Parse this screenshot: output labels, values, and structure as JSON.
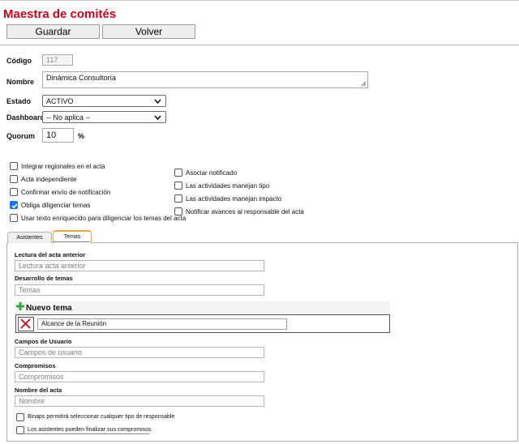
{
  "page": {
    "title": "Maestra de comités",
    "save_label": "Guardar",
    "back_label": "Volver"
  },
  "form": {
    "codigo": {
      "label": "Código",
      "value": "117"
    },
    "nombre": {
      "label": "Nombre",
      "value": "Dinámica Consultoría"
    },
    "estado": {
      "label": "Estado",
      "value": "ACTIVO"
    },
    "dashboard": {
      "label": "Dashboard",
      "value": "-- No aplica --"
    },
    "quorum": {
      "label": "Quorum",
      "value": "10",
      "unit": "%"
    }
  },
  "options_left": [
    {
      "label": "Integrar regionales en el acta",
      "checked": false
    },
    {
      "label": "Acta independiente",
      "checked": false
    },
    {
      "label": "Confirmar envío de notificación",
      "checked": false
    },
    {
      "label": "Obliga diligenciar temas",
      "checked": true
    },
    {
      "label": "Usar texto enriquecido para diligenciar los temas del acta",
      "checked": false
    }
  ],
  "options_right": [
    {
      "label": "Asociar notificado",
      "checked": false
    },
    {
      "label": "Las actividades manejan tipo",
      "checked": false
    },
    {
      "label": "Las actividades manejan impacto",
      "checked": false
    },
    {
      "label": "Notificar avances al responsable del acta",
      "checked": false
    }
  ],
  "tabs": [
    {
      "label": "Asistentes",
      "active": false
    },
    {
      "label": "Temas",
      "active": true
    }
  ],
  "temas_panel": {
    "lectura": {
      "label": "Lectura del acta anterior",
      "placeholder": "Lectura acta anterior"
    },
    "desarrollo": {
      "label": "Desarrollo de temas",
      "placeholder": "Temas"
    },
    "nuevo_tema_label": "Nuevo tema",
    "tema_item_value": "Alcance de la Reunión",
    "campos": {
      "label": "Campos de Usuario",
      "placeholder": "Campos de usuario"
    },
    "compromisos": {
      "label": "Compromisos",
      "placeholder": "Compromisos"
    },
    "nombre_acta": {
      "label": "Nombre del acta",
      "placeholder": "Nombre"
    },
    "check_binaps": {
      "label": "Binaps permitirá seleccionar cualquier tipo de responsable",
      "checked": false
    },
    "check_asistentes": {
      "label": "Los asistentes pueden finalizar sus compromisos",
      "checked": false
    }
  },
  "colors": {
    "title": "#d0021b",
    "checkbox_on": "#1a73e8",
    "tab_accent": "#f0a43a",
    "plus": "#3aa53a",
    "delete": "#d0021b"
  },
  "icons": {
    "dropdown": "chevron-down-icon",
    "add": "plus-icon",
    "delete": "close-icon",
    "check": "check-icon"
  }
}
